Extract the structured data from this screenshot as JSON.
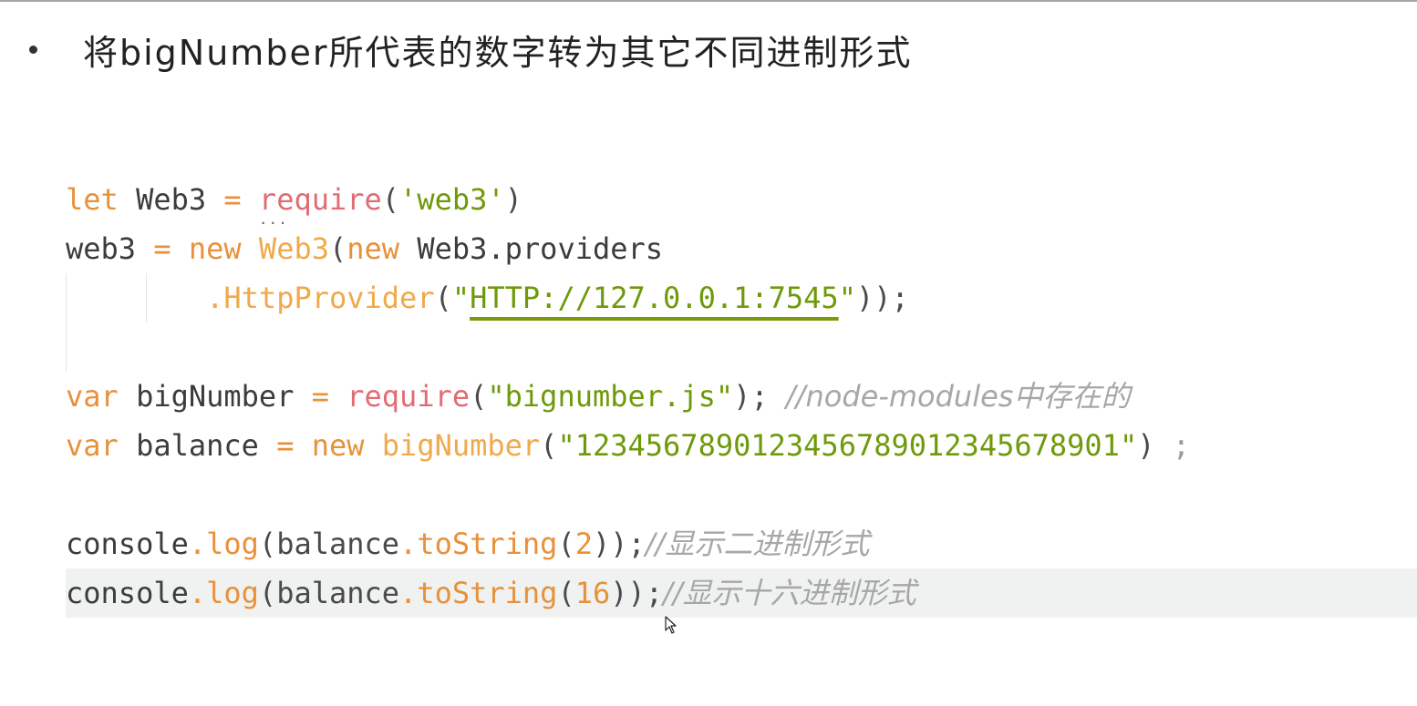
{
  "heading": {
    "text": "将bigNumber所代表的数字转为其它不同进制形式"
  },
  "code": {
    "l1": {
      "kw": "let",
      "ident": " Web3 ",
      "op": "=",
      "sp": " ",
      "fn_r": "r",
      "fn_rest": "equire",
      "p1": "(",
      "str": "'web3'",
      "p2": ")"
    },
    "l2": {
      "ident": "web3 ",
      "op": "=",
      "sp": " ",
      "kw1": "new",
      "sp2": " ",
      "cls": "Web3",
      "p1": "(",
      "kw2": "new",
      "rest": " Web3.providers"
    },
    "l3": {
      "indent": "        ",
      "method": ".HttpProvider",
      "p1": "(",
      "q1": "\"",
      "url": "HTTP://127.0.0.1:7545",
      "q2": "\"",
      "end": "));"
    },
    "l4": {
      "kw": "var",
      "ident": " bigNumber ",
      "op": "=",
      "sp": " ",
      "req": "require",
      "p1": "(",
      "str": "\"bignumber.js\"",
      "end": ");",
      "sp2": " ",
      "cmt": "//node-modules中存在的"
    },
    "l5": {
      "kw": "var",
      "ident": " balance ",
      "op": "=",
      "sp": " ",
      "kw2": "new",
      "sp2": " ",
      "cls": "bigNumber",
      "p1": "(",
      "str": "\"12345678901234567890123456789 01\"",
      "str_exact": "\"1234567890123456789012345678901\"",
      "end": ")",
      "semi": " ;"
    },
    "l6": {
      "obj": "console",
      "dot": ".",
      "fn": "log",
      "p1": "(balance",
      "dot2": ".",
      "fn2": "toString",
      "p2": "(",
      "num": "2",
      "end": "));",
      "cmt": "//显示二进制形式"
    },
    "l7": {
      "obj": "console",
      "dot": ".",
      "fn": "log",
      "p1": "(balance",
      "dot2": ".",
      "fn2": "toString",
      "p2": "(",
      "num": "16",
      "end": "));",
      "cmt": "//显示十六进制形式"
    }
  },
  "colors": {
    "keyword": "#e8913a",
    "string": "#6e9a0a",
    "comment": "#a7a7a7",
    "require": "#e06c75",
    "highlight_line": "#f0f2f2"
  },
  "icons": {
    "cursor": "mouse-pointer-icon"
  }
}
